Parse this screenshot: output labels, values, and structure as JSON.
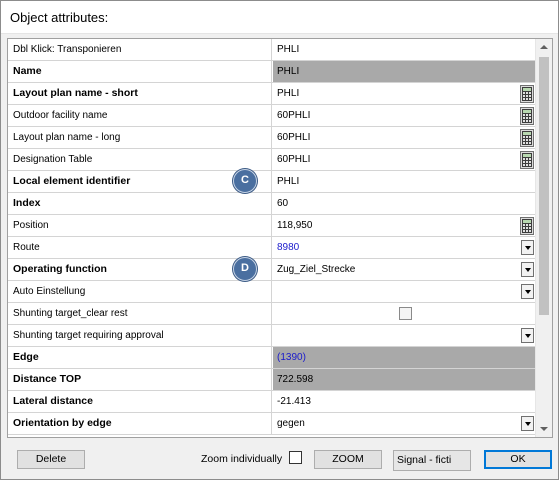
{
  "window": {
    "title": "Object attributes:"
  },
  "grid": {
    "rows": [
      {
        "label": "Dbl Klick: Transponieren",
        "value": "PHLI",
        "label_bold": false,
        "value_gray": false,
        "control": "none"
      },
      {
        "label": "Name",
        "value": "PHLI",
        "label_bold": true,
        "value_gray": true,
        "control": "none"
      },
      {
        "label": "Layout plan name - short",
        "value": "PHLI",
        "label_bold": true,
        "value_gray": false,
        "control": "calculator"
      },
      {
        "label": "Outdoor facility name",
        "value": "60PHLI",
        "label_bold": false,
        "value_gray": false,
        "control": "calculator"
      },
      {
        "label": "Layout plan name - long",
        "value": "60PHLI",
        "label_bold": false,
        "value_gray": false,
        "control": "calculator"
      },
      {
        "label": "Designation Table",
        "value": "60PHLI",
        "label_bold": false,
        "value_gray": false,
        "control": "calculator"
      },
      {
        "label": "Local element identifier",
        "value": "PHLI",
        "label_bold": true,
        "value_gray": false,
        "control": "none",
        "marker": "C"
      },
      {
        "label": "Index",
        "value": "60",
        "label_bold": true,
        "value_gray": false,
        "control": "none"
      },
      {
        "label": "Position",
        "value": "118,950",
        "label_bold": false,
        "value_gray": false,
        "control": "calculator"
      },
      {
        "label": "Route",
        "value": "8980",
        "label_bold": false,
        "value_gray": false,
        "value_blue": true,
        "control": "dropdown"
      },
      {
        "label": "Operating function",
        "value": "Zug_Ziel_Strecke",
        "label_bold": true,
        "value_gray": false,
        "control": "dropdown",
        "marker": "D"
      },
      {
        "label": "Auto Einstellung",
        "value": "",
        "label_bold": false,
        "value_gray": false,
        "control": "dropdown"
      },
      {
        "label": "Shunting target_clear rest",
        "value": "",
        "label_bold": false,
        "value_gray": false,
        "control": "checkbox"
      },
      {
        "label": "Shunting target requiring approval",
        "value": "",
        "label_bold": false,
        "value_gray": false,
        "control": "dropdown"
      },
      {
        "label": "Edge",
        "value": "(1390)",
        "label_bold": true,
        "value_gray": true,
        "value_blue": true,
        "control": "none"
      },
      {
        "label": "Distance TOP",
        "value": "722.598",
        "label_bold": true,
        "value_gray": true,
        "control": "none"
      },
      {
        "label": "Lateral distance",
        "value": "-21.413",
        "label_bold": true,
        "value_gray": false,
        "control": "none"
      },
      {
        "label": "Orientation by edge",
        "value": "gegen",
        "label_bold": true,
        "value_gray": false,
        "control": "dropdown"
      }
    ]
  },
  "footer": {
    "delete_label": "Delete",
    "zoom_individually_label": "Zoom individually",
    "zoom_label": "ZOOM",
    "signal_select_value": "Signal - ficti",
    "ok_label": "OK"
  },
  "colors": {
    "gray_cell": "#a9a9a9",
    "blue_value": "#1a1acc",
    "marker": "#4a6fa0"
  }
}
